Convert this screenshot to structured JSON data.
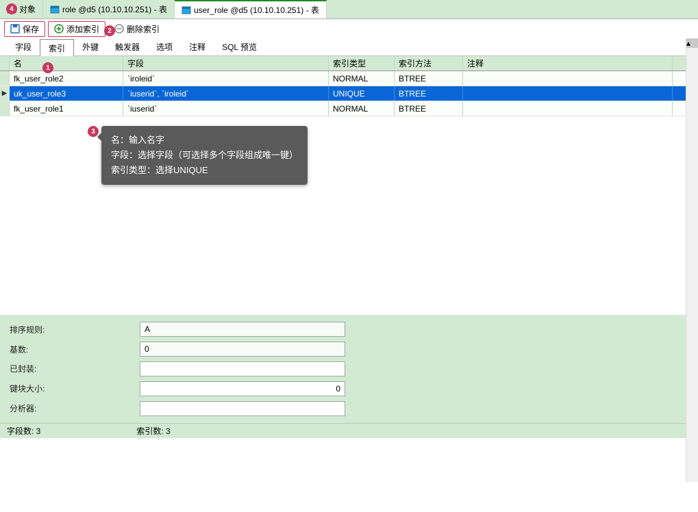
{
  "tabs": [
    {
      "label": "对象",
      "active": false
    },
    {
      "label": "role @d5 (10.10.10.251) - 表",
      "active": false
    },
    {
      "label": "user_role @d5 (10.10.10.251) - 表",
      "active": true
    }
  ],
  "toolbar": {
    "save": "保存",
    "add_index": "添加索引",
    "delete_index": "删除索引"
  },
  "badges": {
    "b1": "1",
    "b2": "2",
    "b3": "3",
    "b4": "4"
  },
  "subtabs": {
    "fields": "字段",
    "indexes": "索引",
    "fks": "外键",
    "triggers": "触发器",
    "options": "选项",
    "comment": "注释",
    "sql": "SQL 预览"
  },
  "grid": {
    "headers": {
      "name": "名",
      "fields": "字段",
      "type": "索引类型",
      "method": "索引方法",
      "comment": "注释"
    },
    "rows": [
      {
        "name": "fk_user_role2",
        "fields": "`iroleid`",
        "type": "NORMAL",
        "method": "BTREE",
        "comment": "",
        "selected": false
      },
      {
        "name": "uk_user_role3",
        "fields": "`iuserid`, `iroleid`",
        "type": "UNIQUE",
        "method": "BTREE",
        "comment": "",
        "selected": true
      },
      {
        "name": "fk_user_role1",
        "fields": "`iuserid`",
        "type": "NORMAL",
        "method": "BTREE",
        "comment": "",
        "selected": false
      }
    ]
  },
  "tooltip": {
    "line1": "名：输入名字",
    "line2": "字段：选择字段（可选择多个字段组成唯一键）",
    "line3": "索引类型：选择UNIQUE"
  },
  "props": {
    "sort_label": "排序规则:",
    "sort_value": "A",
    "cardinality_label": "基数:",
    "cardinality_value": "0",
    "packed_label": "已封装:",
    "packed_value": "",
    "block_label": "键块大小:",
    "block_value": "0",
    "parser_label": "分析器:",
    "parser_value": ""
  },
  "status": {
    "fields": "字段数: 3",
    "indexes": "索引数: 3"
  },
  "colors": {
    "panel": "#d3ead2",
    "select": "#0a66d6",
    "badge": "#c7385f"
  }
}
